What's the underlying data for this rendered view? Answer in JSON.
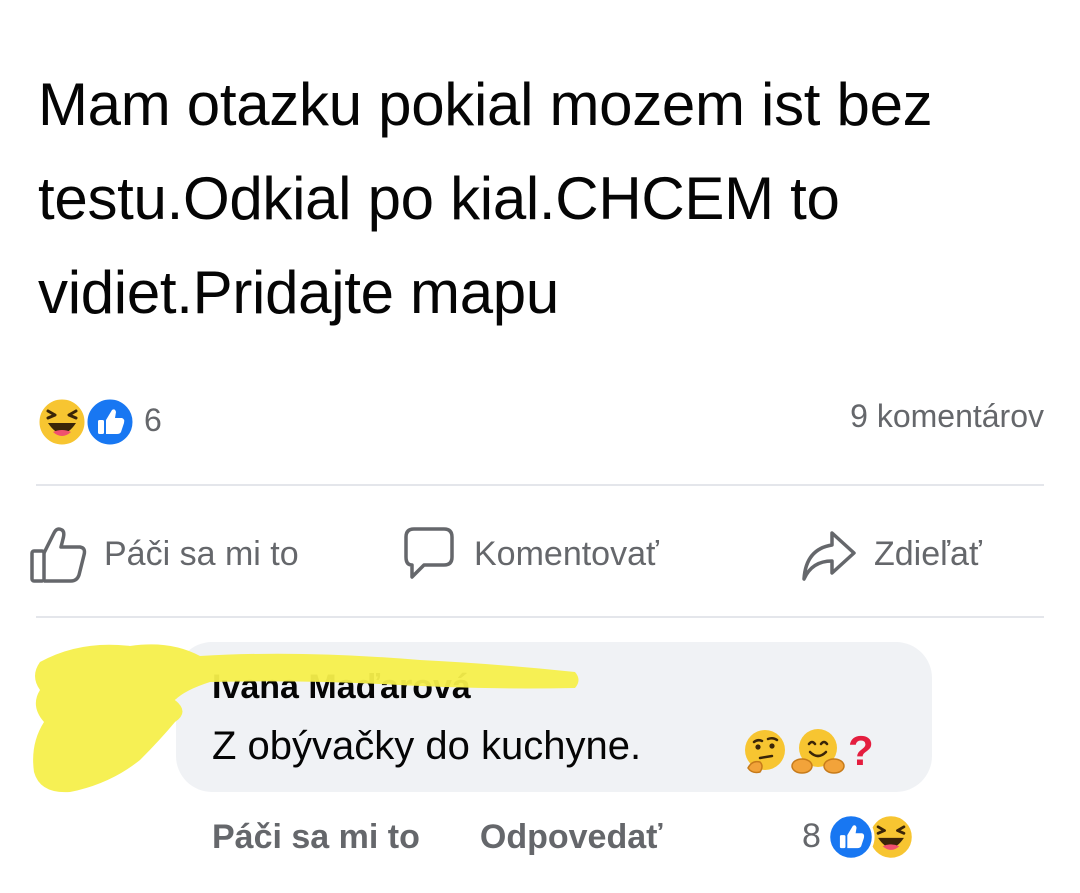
{
  "post": {
    "text": "Mam otazku pokial mozem ist bez testu.Odkial po kial.CHCEM to vidiet.Pridajte mapu",
    "reaction_count": "6",
    "reaction_icons": [
      "haha-icon",
      "like-icon"
    ],
    "comment_count": "9 komentárov"
  },
  "actions": {
    "like_label": "Páči sa mi to",
    "comment_label": "Komentovať",
    "share_label": "Zdieľať"
  },
  "comment": {
    "author": "Ivana Maďarová",
    "text": "Z obývačky do kuchyne.",
    "emojis": [
      "thinking-face-icon",
      "hugging-face-icon",
      "red-question-mark-icon"
    ],
    "question_mark": "?",
    "like_label": "Páči sa mi to",
    "reply_label": "Odpovedať",
    "reaction_count": "8",
    "reaction_icons": [
      "like-icon",
      "haha-icon"
    ]
  },
  "colors": {
    "text": "#050505",
    "secondary": "#65676b",
    "divider": "#e4e6eb",
    "bubble": "#f0f2f5",
    "like_blue": "#1877f2",
    "haha_yellow": "#f7c531",
    "highlighter": "#f6ef4b"
  }
}
